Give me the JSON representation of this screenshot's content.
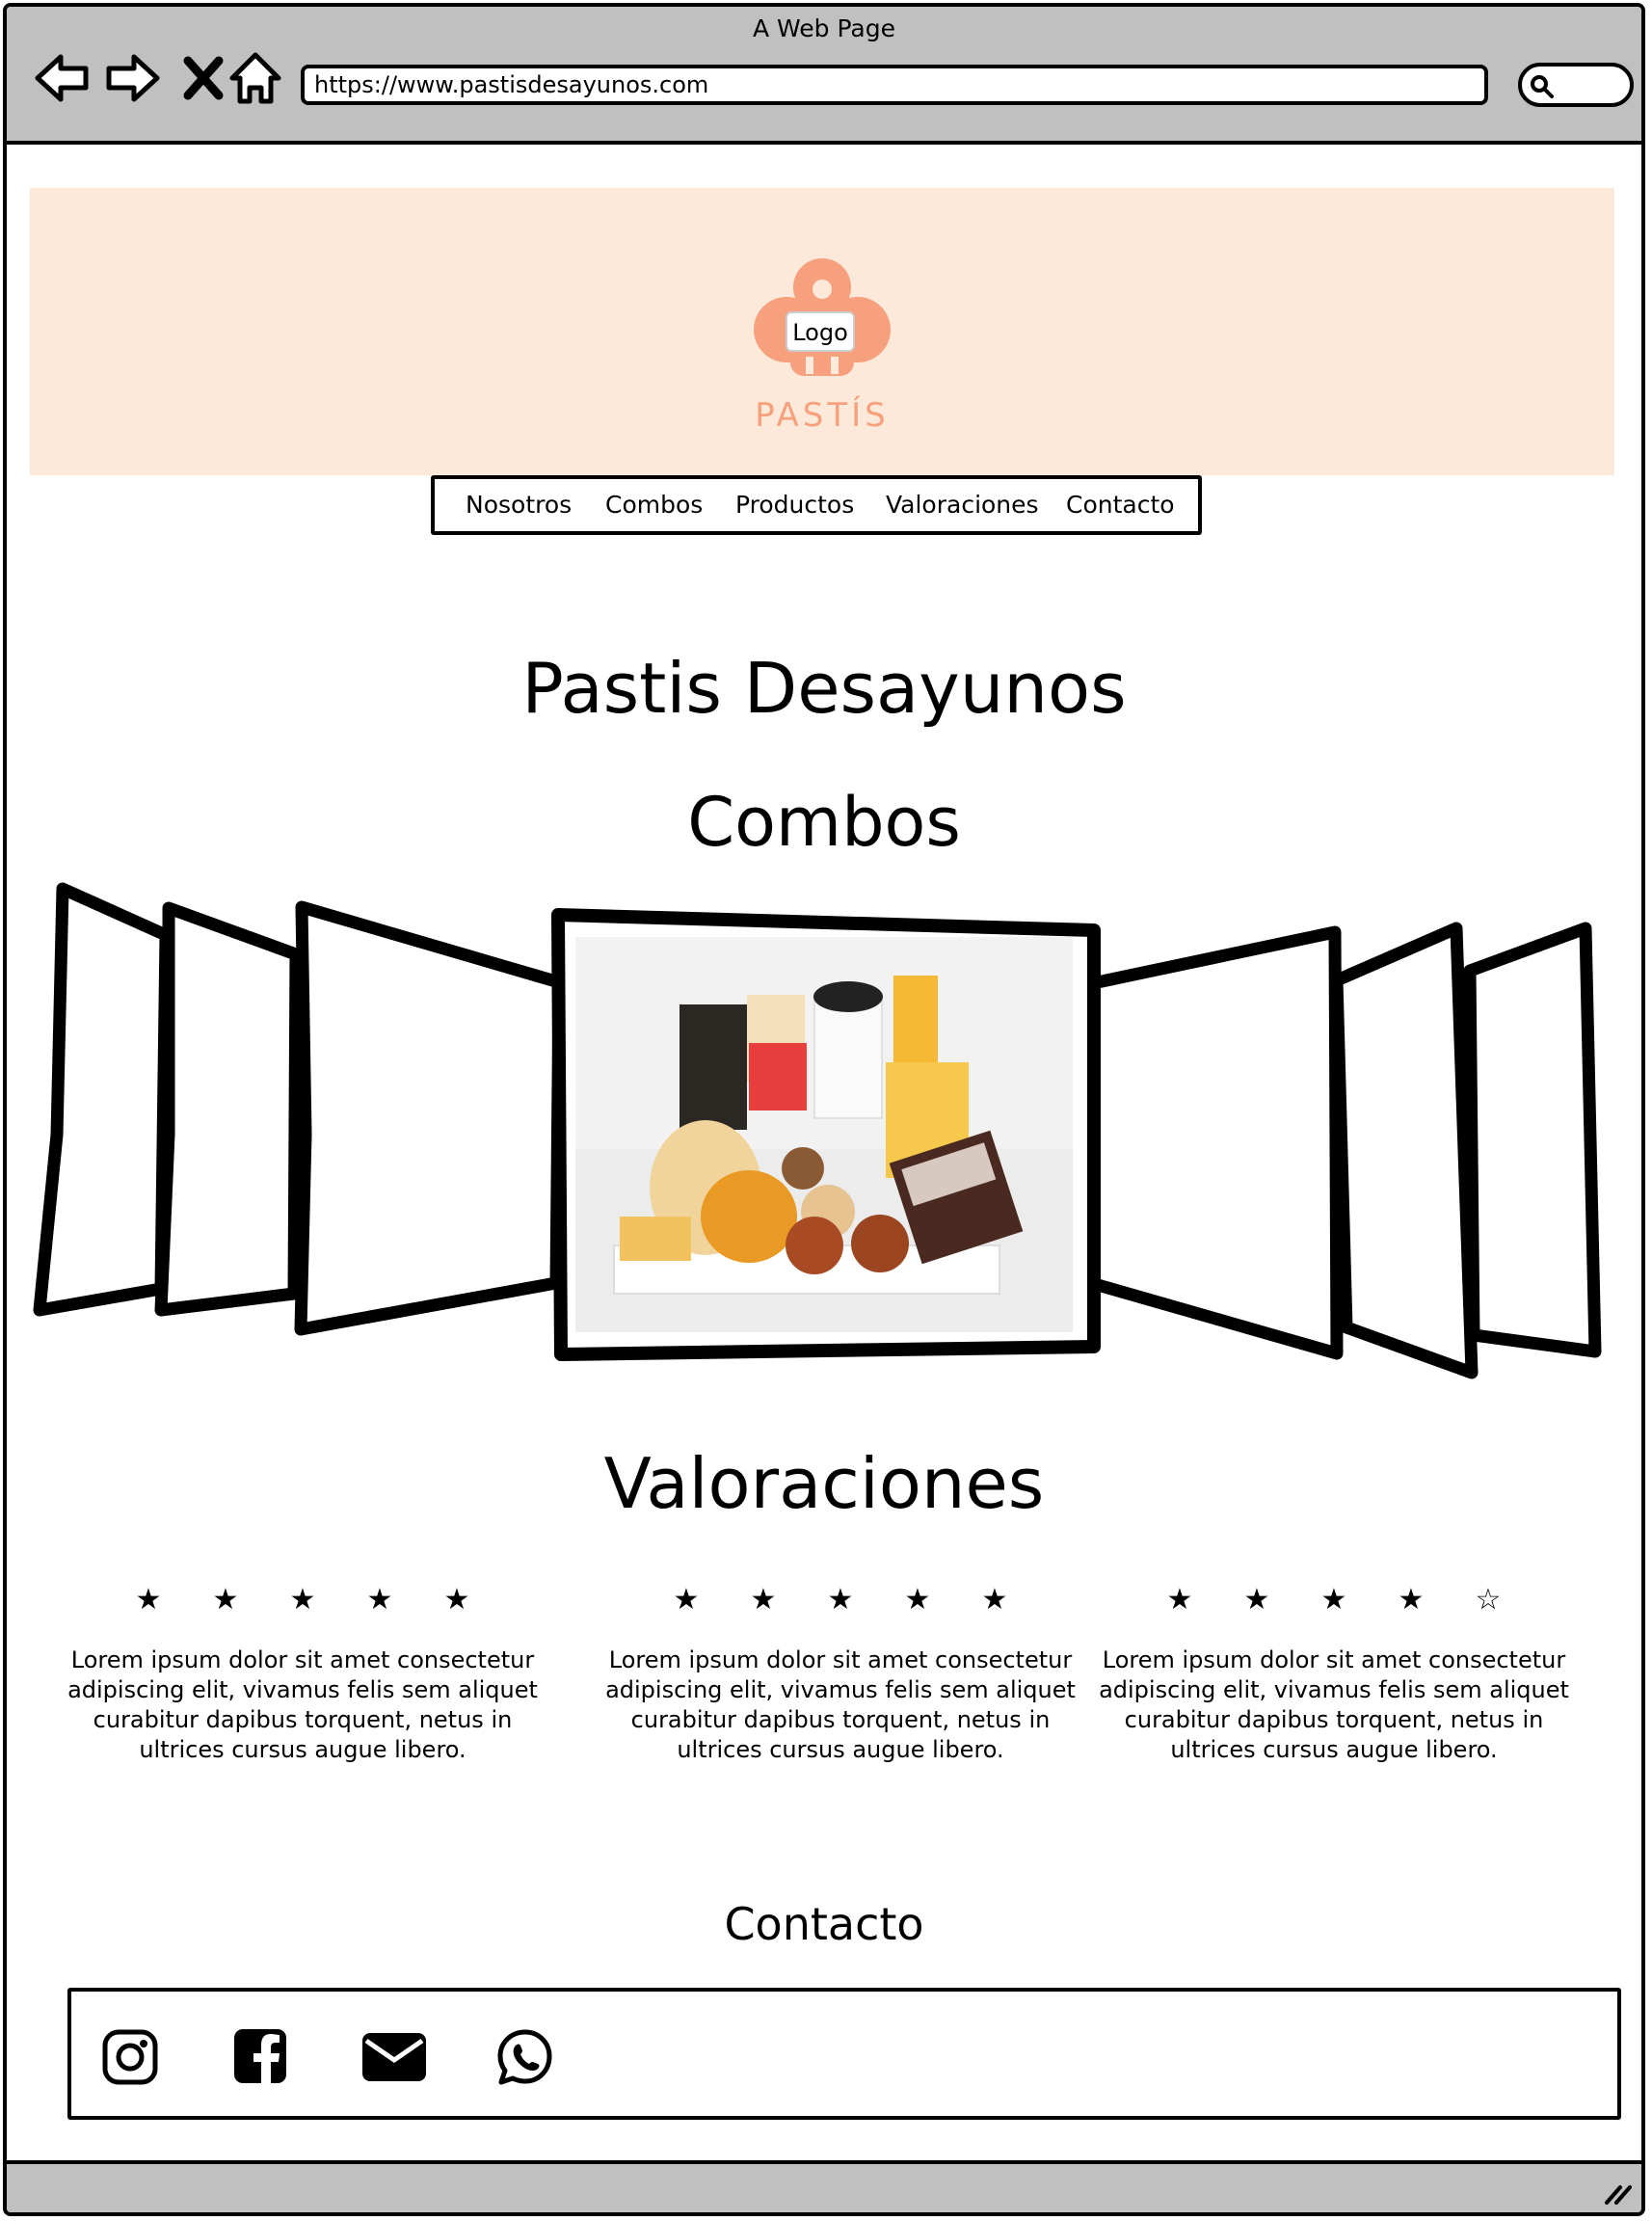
{
  "browser": {
    "window_title": "A Web Page",
    "url": "https://www.pastisdesayunos.com"
  },
  "header": {
    "logo_label": "Logo",
    "brand_name": "PASTÍS",
    "brand_color": "#f7a07d",
    "background_color": "#fce9d9"
  },
  "menu": {
    "items": [
      "Nosotros",
      "Combos",
      "Productos",
      "Valoraciones",
      "Contacto"
    ]
  },
  "main": {
    "title": "Pastis Desayunos",
    "combos_title": "Combos",
    "valoraciones_title": "Valoraciones",
    "contacto_title": "Contacto"
  },
  "reviews": [
    {
      "rating": 5,
      "text": "Lorem ipsum dolor sit amet consectetur adipiscing elit, vivamus felis sem aliquet curabitur dapibus torquent, netus in ultrices cursus augue libero."
    },
    {
      "rating": 5,
      "text": "Lorem ipsum dolor sit amet consectetur adipiscing elit, vivamus felis sem aliquet curabitur dapibus torquent, netus in ultrices cursus augue libero."
    },
    {
      "rating": 4,
      "text": "Lorem ipsum dolor sit amet consectetur adipiscing elit, vivamus felis sem aliquet curabitur dapibus torquent, netus in ultrices cursus augue libero."
    }
  ],
  "contact_icons": [
    "instagram-icon",
    "facebook-icon",
    "email-icon",
    "whatsapp-icon"
  ]
}
